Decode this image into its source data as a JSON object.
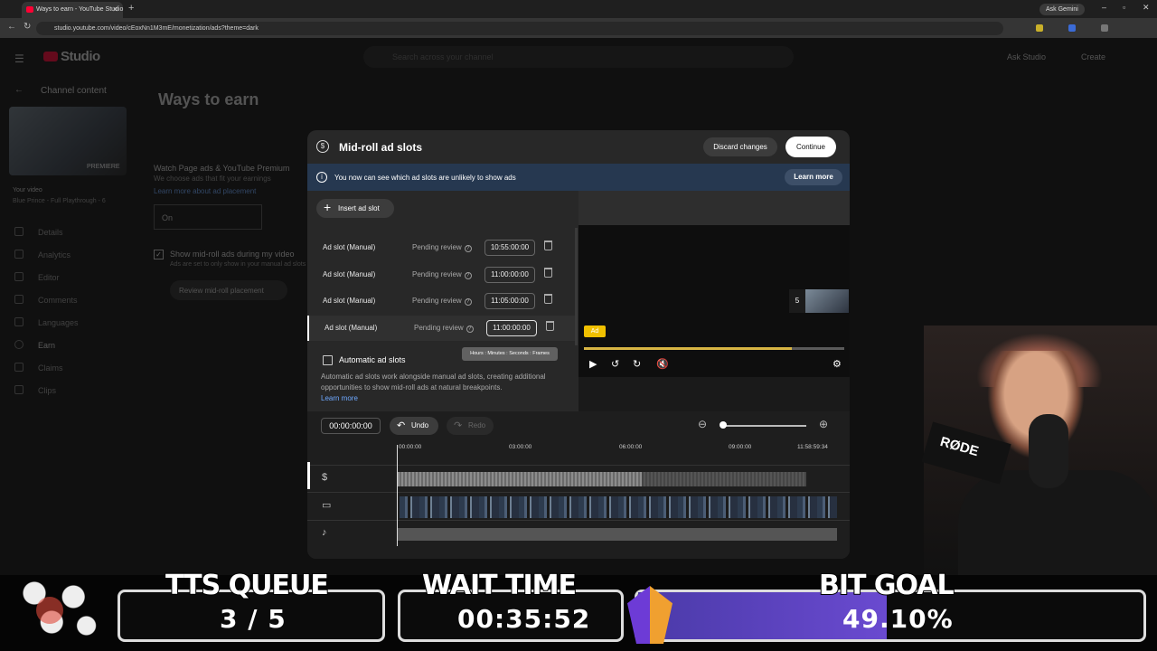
{
  "browser": {
    "tab_title": "Ways to earn - YouTube Studio",
    "url": "studio.youtube.com/video/cEoxNn1M3mE/monetization/ads?theme=dark",
    "gemini_label": "Ask Gemini",
    "new_tab": "+"
  },
  "studio": {
    "logo": "Studio",
    "search_placeholder": "Search across your channel",
    "ask_studio": "Ask Studio",
    "create": "Create",
    "back_label": "Channel content",
    "video_label": "Your video",
    "video_title": "Blue Prince - Full Playthrough - 6",
    "premiere": "PREMIERE",
    "sidebar": [
      {
        "label": "Details"
      },
      {
        "label": "Analytics"
      },
      {
        "label": "Editor"
      },
      {
        "label": "Comments"
      },
      {
        "label": "Languages"
      },
      {
        "label": "Earn"
      },
      {
        "label": "Claims"
      },
      {
        "label": "Clips"
      }
    ],
    "page_title": "Ways to earn",
    "section_title": "Watch Page ads & YouTube Premium",
    "section_desc": "We choose ads that fit your earnings",
    "section_link": "Learn more about ad placement",
    "on_value": "On",
    "show_midroll": "Show mid-roll ads during my video",
    "midroll_desc": "Ads are set to only show in your manual ad slots",
    "review_btn": "Review mid-roll placement"
  },
  "modal": {
    "title": "Mid-roll ad slots",
    "discard": "Discard changes",
    "continue": "Continue",
    "banner_text": "You now can see which ad slots are unlikely to show ads",
    "learn_more": "Learn more",
    "insert": "Insert ad slot",
    "slots": [
      {
        "name": "Ad slot (Manual)",
        "status": "Pending review",
        "time": "10:55:00:00"
      },
      {
        "name": "Ad slot (Manual)",
        "status": "Pending review",
        "time": "11:00:00:00"
      },
      {
        "name": "Ad slot (Manual)",
        "status": "Pending review",
        "time": "11:05:00:00"
      },
      {
        "name": "Ad slot (Manual)",
        "status": "Pending review",
        "time": "11:00:00:00"
      }
    ],
    "tooltip": "Hours : Minutes : Seconds : Frames",
    "auto_label": "Automatic ad slots",
    "auto_desc": "Automatic ad slots work alongside manual ad slots, creating additional opportunities to show mid-roll ads at natural breakpoints.",
    "auto_learn": "Learn more",
    "ad_badge": "Ad",
    "next_count": "5",
    "progress": 0.8
  },
  "timeline": {
    "timecode": "00:00:00:00",
    "undo": "Undo",
    "redo": "Redo",
    "ticks": [
      "00:00:00",
      "03:00:00",
      "06:00:00",
      "09:00:00",
      "11:58:59:34"
    ]
  },
  "overlay": {
    "tts_label": "TTS QUEUE",
    "tts_value": "3 / 5",
    "wait_label": "WAIT TIME",
    "wait_value": "00:35:52",
    "bit_label": "BIT GOAL",
    "bit_value": "49.10%",
    "bit_progress": 0.491
  },
  "webcam": {
    "mic_brand": "RØDE"
  }
}
